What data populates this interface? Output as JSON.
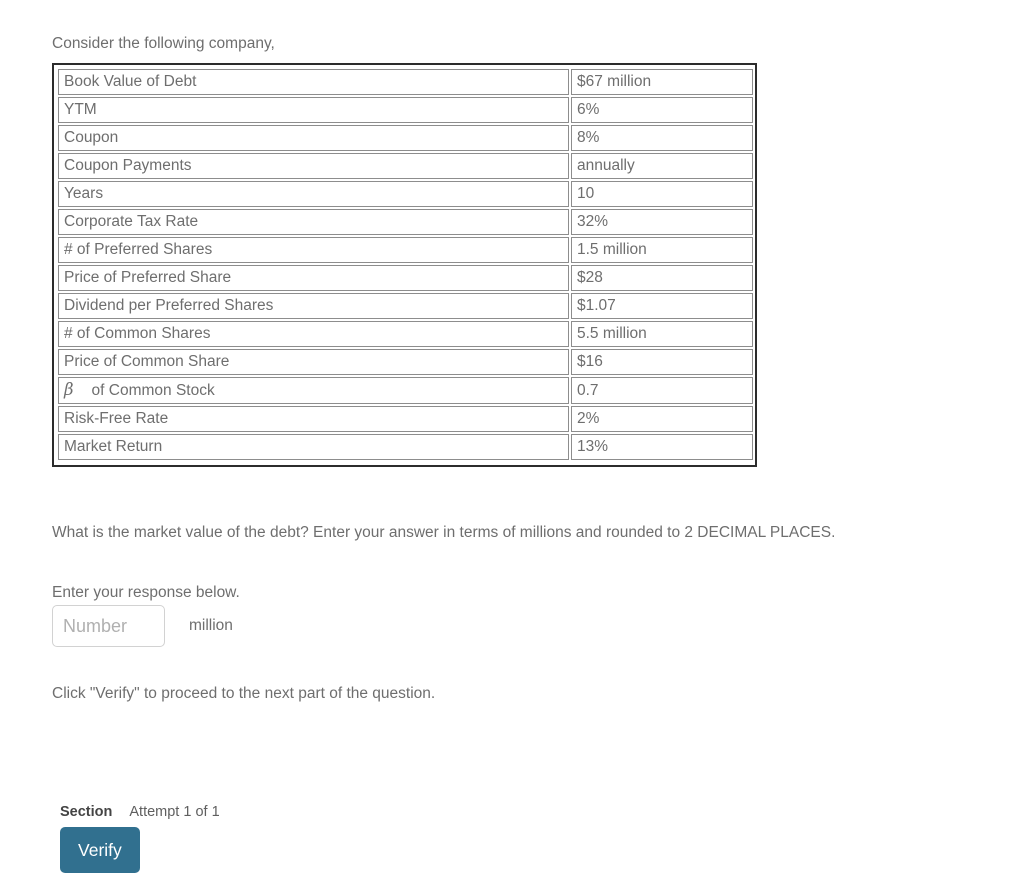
{
  "intro": "Consider the following company,",
  "table": {
    "rows": [
      {
        "label": "Book Value of Debt",
        "value": "$67 million",
        "math": false
      },
      {
        "label": "YTM",
        "value": "6%",
        "math": false
      },
      {
        "label": "Coupon",
        "value": "8%",
        "math": false
      },
      {
        "label": "Coupon Payments",
        "value": "annually",
        "math": false
      },
      {
        "label": "Years",
        "value": "10",
        "math": false
      },
      {
        "label": "Corporate Tax Rate",
        "value": "32%",
        "math": false
      },
      {
        "label": "# of Preferred Shares",
        "value": "1.5 million",
        "math": false
      },
      {
        "label": "Price of Preferred Share",
        "value": "$28",
        "math": false
      },
      {
        "label": "Dividend per Preferred Shares",
        "value": "$1.07",
        "math": false
      },
      {
        "label": "# of Common Shares",
        "value": "5.5 million",
        "math": false
      },
      {
        "label": "Price of Common Share",
        "value": "$16",
        "math": false
      },
      {
        "label": "of Common Stock",
        "value": "0.7",
        "math": true,
        "symbol": "β"
      },
      {
        "label": "Risk-Free Rate",
        "value": "2%",
        "math": false
      },
      {
        "label": "Market Return",
        "value": "13%",
        "math": false
      }
    ]
  },
  "question": "What is the market value of the debt? Enter your answer in terms of millions and rounded to 2 DECIMAL PLACES.",
  "response": {
    "prompt": "Enter your response below.",
    "placeholder": "Number",
    "value": "",
    "unit": "million"
  },
  "verify_note": "Click \"Verify\" to proceed to the next part of the question.",
  "footer": {
    "section_label": "Section",
    "attempt_label": "Attempt 1 of 1",
    "verify_button": "Verify",
    "button_color": "#31708f"
  }
}
